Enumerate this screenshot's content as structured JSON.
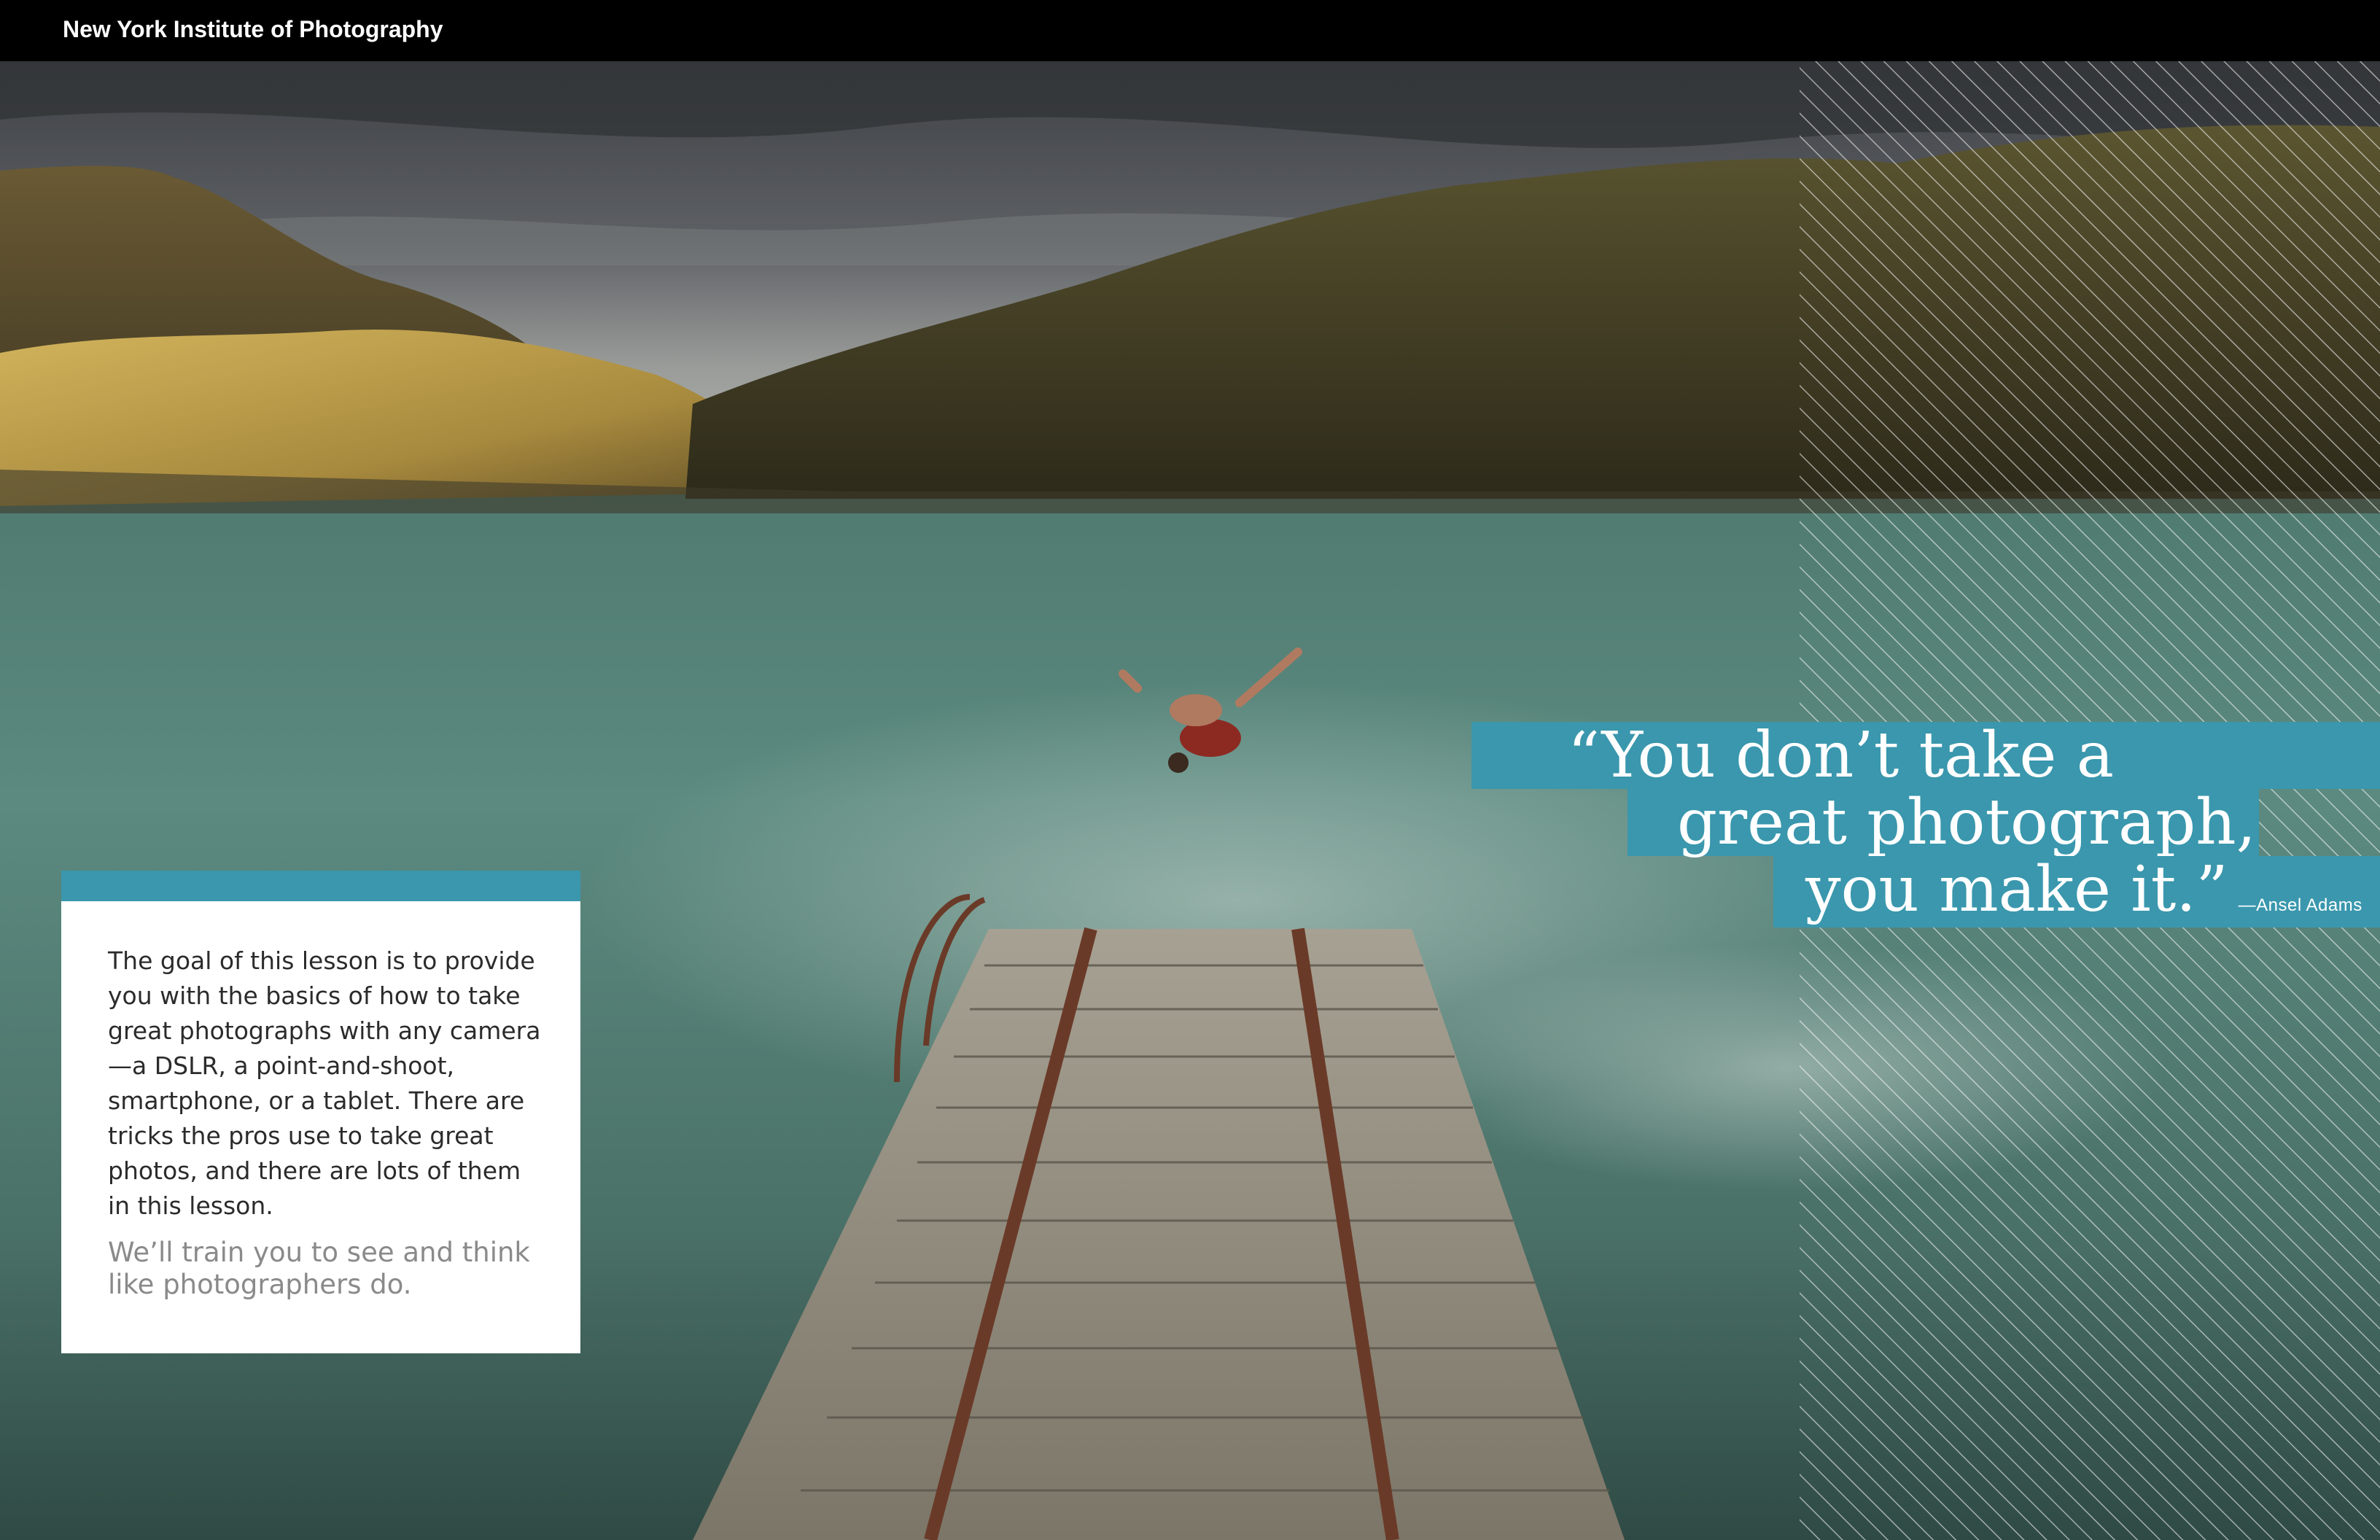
{
  "header": {
    "brand_prefix": "New York Institute of",
    "brand_name": "Photography"
  },
  "colors": {
    "accent_teal": "#3a97ad",
    "header_black": "#000000",
    "card_white": "#ffffff"
  },
  "intro_card": {
    "paragraph_1": "The goal of this lesson is to provide you with the basics of how to take great photographs with any camera—a DSLR, a point-and-shoot, smartphone, or a tablet. There are tricks the pros use to take great photos, and there are lots of them in this lesson.",
    "paragraph_2": "We’ll train you to see and think like photographers do."
  },
  "quote": {
    "line_1": "“You don’t take a",
    "line_2": "great photograph,",
    "line_3": "you make it.”",
    "attribution": "—Ansel Adams"
  }
}
